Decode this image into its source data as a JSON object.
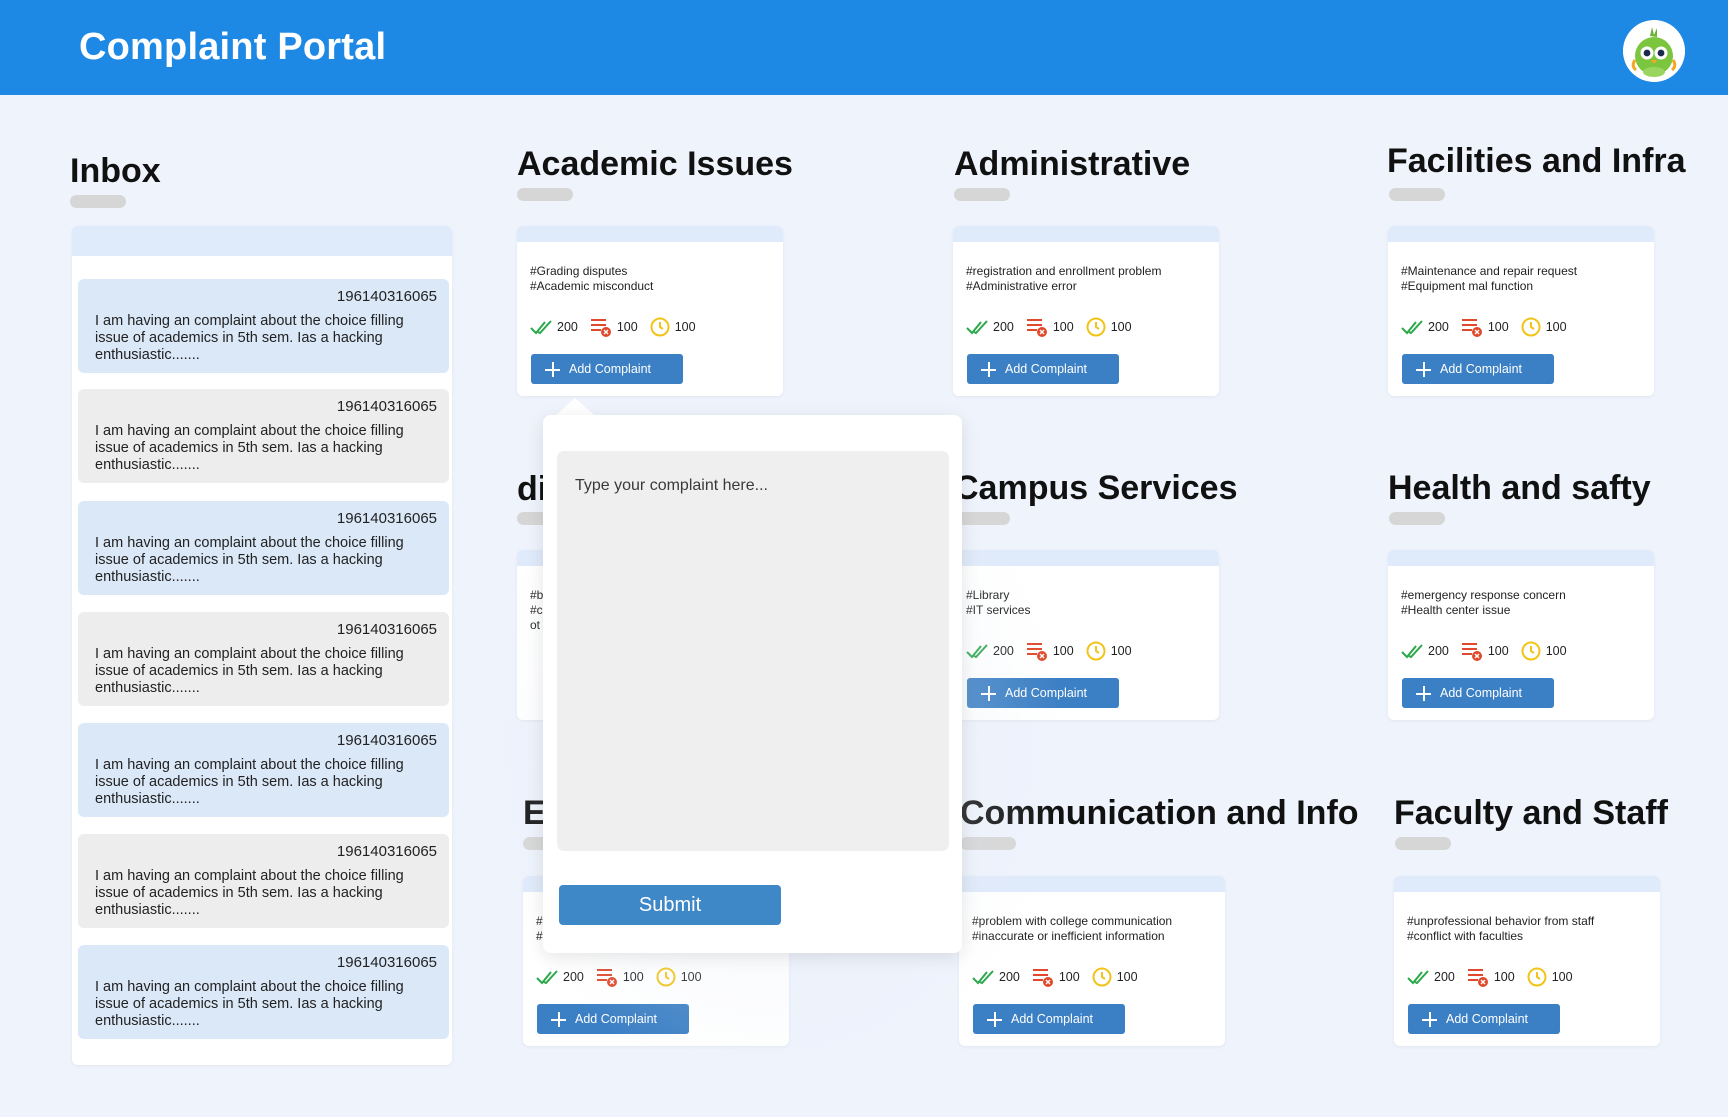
{
  "header": {
    "title": "Complaint Portal",
    "avatar_icon": "parrot-avatar-icon",
    "brand_color": "#1e88e5"
  },
  "inbox": {
    "title": "Inbox",
    "messages": [
      {
        "id": "196140316065",
        "text": "I am having an complaint about the choice filling issue of academics in 5th sem. Ias a hacking enthusiastic......."
      },
      {
        "id": "196140316065",
        "text": "I am having an complaint about the choice filling issue of academics in 5th sem. Ias a hacking enthusiastic......."
      },
      {
        "id": "196140316065",
        "text": "I am having an complaint about the choice filling issue of academics in 5th sem. Ias a hacking enthusiastic......."
      },
      {
        "id": "196140316065",
        "text": "I am having an complaint about the choice filling issue of academics in 5th sem. Ias a hacking enthusiastic......."
      },
      {
        "id": "196140316065",
        "text": "I am having an complaint about the choice filling issue of academics in 5th sem. Ias a hacking enthusiastic......."
      },
      {
        "id": "196140316065",
        "text": "I am having an complaint about the choice filling issue of academics in 5th sem. Ias a hacking enthusiastic......."
      },
      {
        "id": "196140316065",
        "text": "I am having an complaint about the choice filling issue of academics in 5th sem. Ias a hacking enthusiastic......."
      }
    ]
  },
  "categories": [
    {
      "title": "Academic Issues",
      "tags": "#Grading disputes\n#Academic misconduct",
      "resolved": "200",
      "rejected": "100",
      "pending": "100",
      "button": "Add Complaint"
    },
    {
      "title": "Administrative",
      "tags": "#registration and enrollment problem\n#Administrative error",
      "resolved": "200",
      "rejected": "100",
      "pending": "100",
      "button": "Add Complaint"
    },
    {
      "title": "Facilities and Infra",
      "tags": "#Maintenance and repair request\n#Equipment mal function",
      "resolved": "200",
      "rejected": "100",
      "pending": "100",
      "button": "Add Complaint"
    },
    {
      "title": "di",
      "tags": "#b\n#c\not",
      "resolved": "",
      "rejected": "",
      "pending": "",
      "button": ""
    },
    {
      "title": "Campus Services",
      "tags": "#Library\n#IT services",
      "resolved": "200",
      "rejected": "100",
      "pending": "100",
      "button": "Add Complaint"
    },
    {
      "title": "Health and safty",
      "tags": "#emergency response concern\n#Health center issue",
      "resolved": "200",
      "rejected": "100",
      "pending": "100",
      "button": "Add Complaint"
    },
    {
      "title": "E",
      "tags": "#\n#",
      "resolved": "200",
      "rejected": "100",
      "pending": "100",
      "button": "Add Complaint"
    },
    {
      "title": "Communication and Info",
      "tags": "#problem with college communication\n#inaccurate or inefficient information",
      "resolved": "200",
      "rejected": "100",
      "pending": "100",
      "button": "Add Complaint"
    },
    {
      "title": "Faculty and Staff",
      "tags": "#unprofessional behavior from staff\n#conflict with faculties",
      "resolved": "200",
      "rejected": "100",
      "pending": "100",
      "button": "Add Complaint"
    }
  ],
  "icons": {
    "resolved": "double-check-icon",
    "rejected": "list-cancel-icon",
    "pending": "clock-icon",
    "add": "plus-icon"
  },
  "colors": {
    "resolved": "#2aa84a",
    "rejected": "#e0492b",
    "pending": "#f2c417",
    "button": "#3b7fc4"
  },
  "popup": {
    "placeholder": "Type your complaint here...",
    "submit_label": "Submit"
  }
}
